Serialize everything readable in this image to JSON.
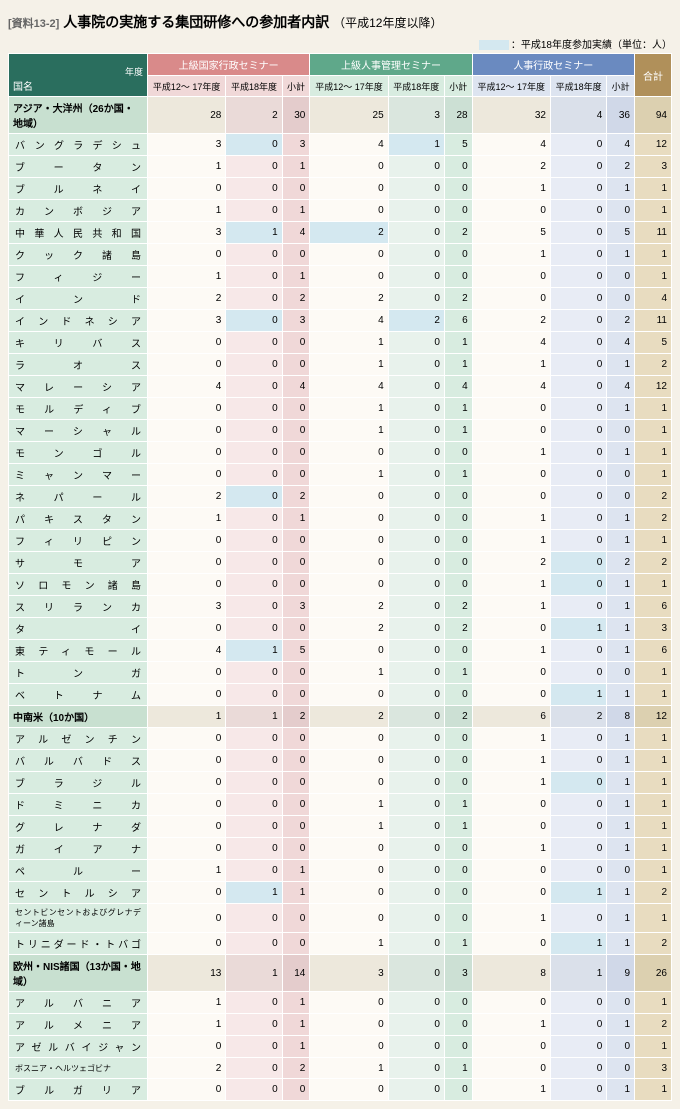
{
  "tag": "[資料13-2]",
  "title": "人事院の実施する集団研修への参加者内訳",
  "subtitle": "（平成12年度以降）",
  "legend": "：平成18年度参加実績（単位：人）",
  "cols": {
    "country": "国名",
    "year": "年度",
    "sem1": "上級国家行政セミナー",
    "sem2": "上級人事管理セミナー",
    "sem3": "人事行政セミナー",
    "total": "合計",
    "p1": "平成12～\n17年度",
    "p2": "平成18年度",
    "st": "小計"
  },
  "rows": [
    {
      "g": 1,
      "n": "アジア・大洋州（26か国・地域）",
      "v": [
        28,
        2,
        30,
        25,
        3,
        28,
        32,
        4,
        36,
        94
      ]
    },
    {
      "n": "バングラデシュ",
      "v": [
        3,
        0,
        3,
        4,
        1,
        5,
        4,
        0,
        4,
        12
      ],
      "hl": [
        1,
        4
      ]
    },
    {
      "n": "ブータン",
      "v": [
        1,
        0,
        1,
        0,
        0,
        0,
        2,
        0,
        2,
        3
      ]
    },
    {
      "n": "ブルネイ",
      "v": [
        0,
        0,
        0,
        0,
        0,
        0,
        1,
        0,
        1,
        1
      ]
    },
    {
      "n": "カンボジア",
      "v": [
        1,
        0,
        1,
        0,
        0,
        0,
        0,
        0,
        0,
        1
      ]
    },
    {
      "n": "中華人民共和国",
      "v": [
        3,
        1,
        4,
        2,
        0,
        2,
        5,
        0,
        5,
        11
      ],
      "hl": [
        1,
        3
      ]
    },
    {
      "n": "クック諸島",
      "v": [
        0,
        0,
        0,
        0,
        0,
        0,
        1,
        0,
        1,
        1
      ]
    },
    {
      "n": "フィジー",
      "v": [
        1,
        0,
        1,
        0,
        0,
        0,
        0,
        0,
        0,
        1
      ]
    },
    {
      "n": "インド",
      "v": [
        2,
        0,
        2,
        2,
        0,
        2,
        0,
        0,
        0,
        4
      ]
    },
    {
      "n": "インドネシア",
      "v": [
        3,
        0,
        3,
        4,
        2,
        6,
        2,
        0,
        2,
        11
      ],
      "hl": [
        1,
        4
      ]
    },
    {
      "n": "キリバス",
      "v": [
        0,
        0,
        0,
        1,
        0,
        1,
        4,
        0,
        4,
        5
      ]
    },
    {
      "n": "ラオス",
      "v": [
        0,
        0,
        0,
        1,
        0,
        1,
        1,
        0,
        1,
        2
      ]
    },
    {
      "n": "マレーシア",
      "v": [
        4,
        0,
        4,
        4,
        0,
        4,
        4,
        0,
        4,
        12
      ]
    },
    {
      "n": "モルディブ",
      "v": [
        0,
        0,
        0,
        1,
        0,
        1,
        0,
        0,
        1,
        1
      ]
    },
    {
      "n": "マーシャル",
      "v": [
        0,
        0,
        0,
        1,
        0,
        1,
        0,
        0,
        0,
        1
      ]
    },
    {
      "n": "モンゴル",
      "v": [
        0,
        0,
        0,
        0,
        0,
        0,
        1,
        0,
        1,
        1
      ]
    },
    {
      "n": "ミャンマー",
      "v": [
        0,
        0,
        0,
        1,
        0,
        1,
        0,
        0,
        0,
        1
      ]
    },
    {
      "n": "ネパール",
      "v": [
        2,
        0,
        2,
        0,
        0,
        0,
        0,
        0,
        0,
        2
      ],
      "hl": [
        1
      ]
    },
    {
      "n": "パキスタン",
      "v": [
        1,
        0,
        1,
        0,
        0,
        0,
        1,
        0,
        1,
        2
      ]
    },
    {
      "n": "フィリピン",
      "v": [
        0,
        0,
        0,
        0,
        0,
        0,
        1,
        0,
        1,
        1
      ]
    },
    {
      "n": "サモア",
      "v": [
        0,
        0,
        0,
        0,
        0,
        0,
        2,
        0,
        2,
        2
      ],
      "hl": [
        7
      ]
    },
    {
      "n": "ソロモン諸島",
      "v": [
        0,
        0,
        0,
        0,
        0,
        0,
        1,
        0,
        1,
        1
      ],
      "hl": [
        7
      ]
    },
    {
      "n": "スリランカ",
      "v": [
        3,
        0,
        3,
        2,
        0,
        2,
        1,
        0,
        1,
        6
      ]
    },
    {
      "n": "タイ",
      "v": [
        0,
        0,
        0,
        2,
        0,
        2,
        0,
        1,
        1,
        3
      ],
      "hl": [
        7
      ]
    },
    {
      "n": "東ティモール",
      "v": [
        4,
        1,
        5,
        0,
        0,
        0,
        1,
        0,
        1,
        6
      ],
      "hl": [
        1
      ]
    },
    {
      "n": "トンガ",
      "v": [
        0,
        0,
        0,
        1,
        0,
        1,
        0,
        0,
        0,
        1
      ]
    },
    {
      "n": "ベトナム",
      "v": [
        0,
        0,
        0,
        0,
        0,
        0,
        0,
        1,
        1,
        1
      ],
      "hl": [
        7
      ]
    },
    {
      "g": 1,
      "n": "中南米（10か国）",
      "v": [
        1,
        1,
        2,
        2,
        0,
        2,
        6,
        2,
        8,
        12
      ]
    },
    {
      "n": "アルゼンチン",
      "v": [
        0,
        0,
        0,
        0,
        0,
        0,
        1,
        0,
        1,
        1
      ]
    },
    {
      "n": "バルバドス",
      "v": [
        0,
        0,
        0,
        0,
        0,
        0,
        1,
        0,
        1,
        1
      ]
    },
    {
      "n": "ブラジル",
      "v": [
        0,
        0,
        0,
        0,
        0,
        0,
        1,
        0,
        1,
        1
      ],
      "hl": [
        7
      ]
    },
    {
      "n": "ドミニカ",
      "v": [
        0,
        0,
        0,
        1,
        0,
        1,
        0,
        0,
        1,
        1
      ]
    },
    {
      "n": "グレナダ",
      "v": [
        0,
        0,
        0,
        1,
        0,
        1,
        0,
        0,
        1,
        1
      ]
    },
    {
      "n": "ガイアナ",
      "v": [
        0,
        0,
        0,
        0,
        0,
        0,
        1,
        0,
        1,
        1
      ]
    },
    {
      "n": "ペルー",
      "v": [
        1,
        0,
        1,
        0,
        0,
        0,
        0,
        0,
        0,
        1
      ]
    },
    {
      "n": "セントルシア",
      "v": [
        0,
        1,
        1,
        0,
        0,
        0,
        0,
        1,
        1,
        2
      ],
      "hl": [
        1,
        7
      ]
    },
    {
      "n": "セントビンセントおよびグレナディーン諸島",
      "v": [
        0,
        0,
        0,
        0,
        0,
        0,
        1,
        0,
        1,
        1
      ],
      "sm": 1
    },
    {
      "n": "トリニダード・トバゴ",
      "v": [
        0,
        0,
        0,
        1,
        0,
        1,
        0,
        1,
        1,
        2
      ],
      "hl": [
        7
      ]
    },
    {
      "g": 1,
      "n": "欧州・NIS諸国（13か国・地域）",
      "v": [
        13,
        1,
        14,
        3,
        0,
        3,
        8,
        1,
        9,
        26
      ]
    },
    {
      "n": "アルバニア",
      "v": [
        1,
        0,
        1,
        0,
        0,
        0,
        0,
        0,
        0,
        1
      ]
    },
    {
      "n": "アルメニア",
      "v": [
        1,
        0,
        1,
        0,
        0,
        0,
        1,
        0,
        1,
        2
      ]
    },
    {
      "n": "アゼルバイジャン",
      "v": [
        0,
        0,
        1,
        0,
        0,
        0,
        0,
        0,
        0,
        1
      ]
    },
    {
      "n": "ボスニア・ヘルツェゴビナ",
      "v": [
        2,
        0,
        2,
        1,
        0,
        1,
        0,
        0,
        0,
        3
      ],
      "sm": 1
    },
    {
      "n": "ブルガリア",
      "v": [
        0,
        0,
        0,
        0,
        0,
        0,
        1,
        0,
        1,
        1
      ]
    }
  ]
}
